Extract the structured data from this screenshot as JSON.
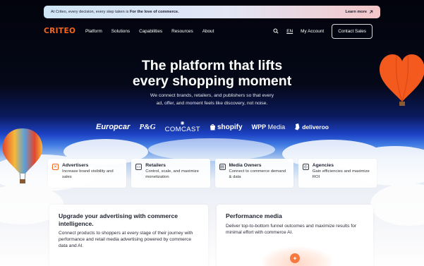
{
  "banner": {
    "text_prefix": "At Criteo, every decision, every step taken is ",
    "text_bold": "For the love of commerce.",
    "link": "Learn more",
    "link_icon": "arrow-up-right-icon"
  },
  "nav": {
    "logo": "CRITEO",
    "menu": [
      "Platform",
      "Solutions",
      "Capabilities",
      "Resources",
      "About"
    ],
    "search_icon": "search-icon",
    "language": "EN",
    "account": "My Account",
    "cta": "Contact Sales"
  },
  "hero": {
    "title_line1": "The platform that lifts",
    "title_line2": "every shopping moment",
    "sub_line1": "We connect brands, retailers, and publishers so that every",
    "sub_line2": "ad, offer, and moment feels like discovery, not noise."
  },
  "partners": {
    "europcar": "Europcar",
    "pg": "P&G",
    "comcast": "COMCAST",
    "shopify": "shopify",
    "wpp_a": "WPP",
    "wpp_b": "Media",
    "deliveroo": "deliveroo"
  },
  "audiences": [
    {
      "title": "Advertisers",
      "desc": "Increase brand visibility and sales",
      "icon": "advertisers-icon"
    },
    {
      "title": "Retailers",
      "desc": "Control, scale, and maximize monetization",
      "icon": "retail-register-icon"
    },
    {
      "title": "Media Owners",
      "desc": "Connect to commerce demand & data",
      "icon": "media-icon"
    },
    {
      "title": "Agencies",
      "desc": "Gain efficiencies and maximize ROI",
      "icon": "agency-icon"
    }
  ],
  "panels": {
    "left_title": "Upgrade your advertising with commerce intelligence.",
    "left_text": "Connect products to shoppers at every stage of their journey with performance and retail media advertising powered by commerce data and AI.",
    "right_title": "Performance media",
    "right_text": "Deliver top-to-bottom funnel outcomes and maximize results for minimal effort with commerce AI.",
    "sparkle_icon": "sparkle-icon"
  },
  "colors": {
    "brand_orange": "#f6641e",
    "hero_dark": "#02030c",
    "sky_blue": "#1c41c4"
  }
}
